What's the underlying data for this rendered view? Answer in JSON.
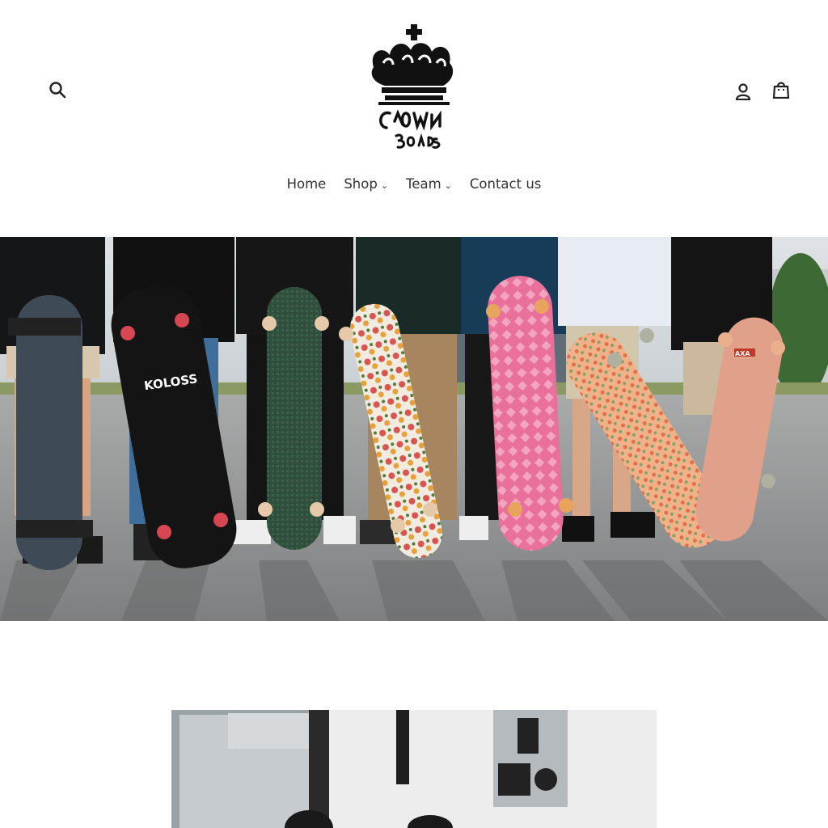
{
  "header": {
    "search_icon": "search-icon",
    "account_icon": "user-icon",
    "cart_icon": "shopping-bag-icon",
    "logo_text": "Crown Boards"
  },
  "nav": {
    "items": [
      {
        "label": "Home",
        "has_dropdown": false
      },
      {
        "label": "Shop",
        "has_dropdown": true
      },
      {
        "label": "Team",
        "has_dropdown": true
      },
      {
        "label": "Contact us",
        "has_dropdown": false
      }
    ],
    "caret_glyph": "⌄"
  },
  "hero": {
    "board_texts": [
      "KOLOSS",
      "AXA"
    ]
  },
  "colors": {
    "text": "#333333",
    "background": "#ffffff"
  }
}
